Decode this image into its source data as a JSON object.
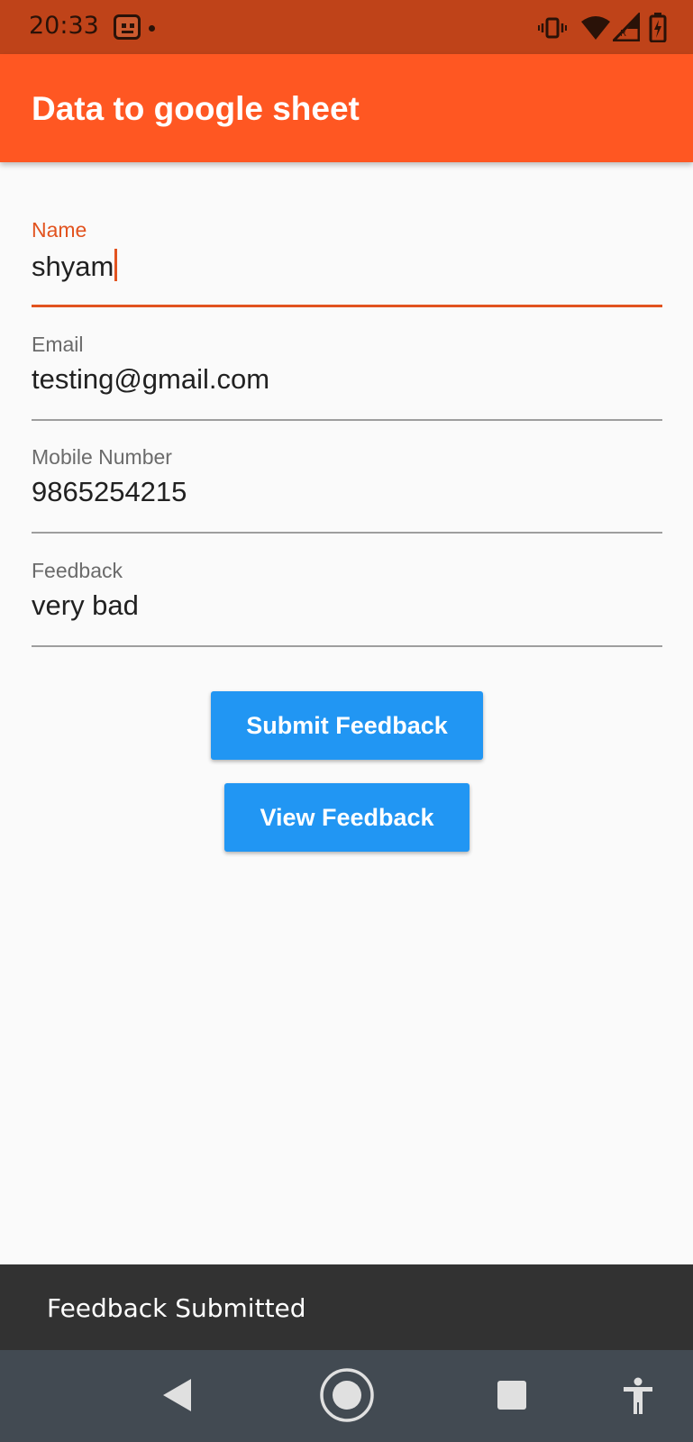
{
  "status_bar": {
    "time": "20:33",
    "icons": [
      "app-notification-icon",
      "vibrate-icon",
      "wifi-icon",
      "signal-roaming-icon",
      "battery-charging-icon"
    ]
  },
  "app_bar": {
    "title": "Data to google sheet",
    "color": "#ff5722"
  },
  "form": {
    "name": {
      "label": "Name",
      "value": "shyam"
    },
    "email": {
      "label": "Email",
      "value": "testing@gmail.com"
    },
    "mobile": {
      "label": "Mobile Number",
      "value": "9865254215"
    },
    "feedback": {
      "label": "Feedback",
      "value": "very bad"
    }
  },
  "buttons": {
    "submit": "Submit Feedback",
    "view": "View Feedback",
    "color": "#2196f3"
  },
  "snackbar": {
    "message": "Feedback Submitted"
  },
  "nav_bar": {
    "icons": [
      "back-icon",
      "home-icon",
      "recents-icon",
      "accessibility-icon"
    ]
  }
}
